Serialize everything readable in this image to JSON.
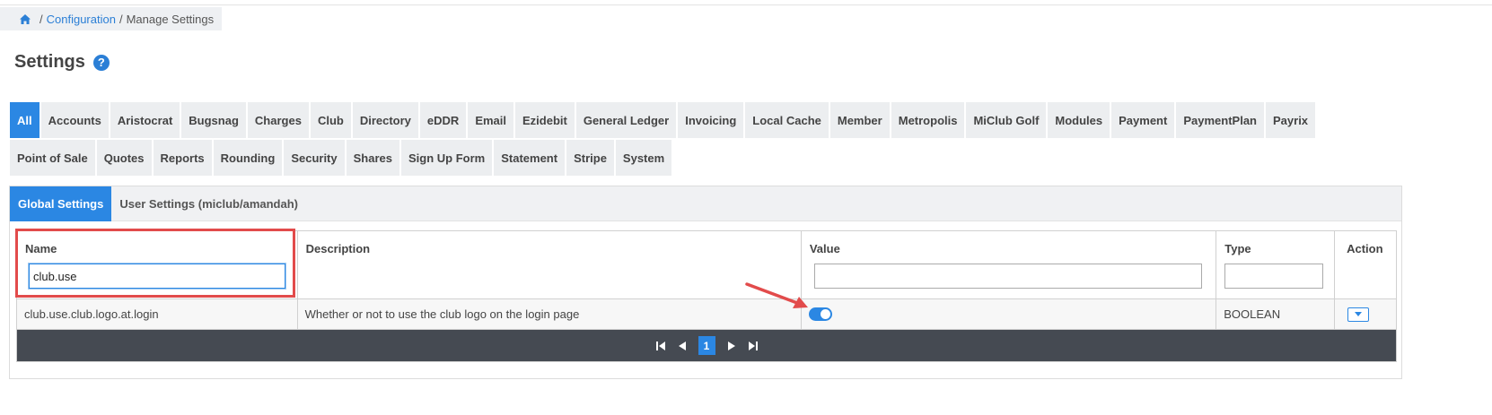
{
  "breadcrumb": {
    "icon": "home-icon",
    "sep1": "/",
    "link": "Configuration",
    "sep2": "/",
    "current": "Manage Settings"
  },
  "page": {
    "title": "Settings",
    "help_icon": "question-circle-icon",
    "help_glyph": "?"
  },
  "category_tabs": {
    "row1": [
      "All",
      "Accounts",
      "Aristocrat",
      "Bugsnag",
      "Charges",
      "Club",
      "Directory",
      "eDDR",
      "Email",
      "Ezidebit",
      "General Ledger",
      "Invoicing",
      "Local Cache",
      "Member",
      "Metropolis",
      "MiClub Golf",
      "Modules",
      "Payment",
      "PaymentPlan",
      "Payrix"
    ],
    "row2": [
      "Point of Sale",
      "Quotes",
      "Reports",
      "Rounding",
      "Security",
      "Shares",
      "Sign Up Form",
      "Statement",
      "Stripe",
      "System"
    ],
    "active": "All"
  },
  "sub_tabs": {
    "global": "Global Settings",
    "user": "User Settings (miclub/amandah)",
    "active": "global"
  },
  "grid": {
    "columns": {
      "name": "Name",
      "description": "Description",
      "value": "Value",
      "type": "Type",
      "action": "Action"
    },
    "filters": {
      "name": "club.use",
      "value": "",
      "type": ""
    },
    "rows": [
      {
        "name": "club.use.club.logo.at.login",
        "description": "Whether or not to use the club logo on the login page",
        "value_on": true,
        "type": "BOOLEAN"
      }
    ],
    "pager": {
      "current_page": "1"
    }
  },
  "colors": {
    "accent": "#2b87e3",
    "link": "#2b7fd6",
    "annotation": "#e24b4b",
    "pager_bg": "#454a52"
  }
}
